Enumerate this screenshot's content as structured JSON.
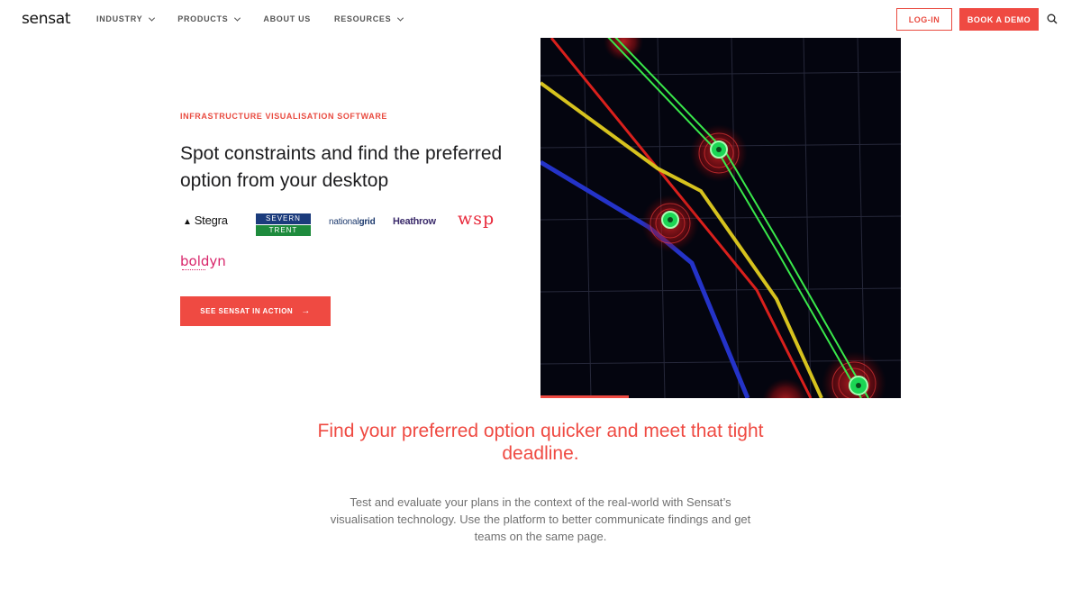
{
  "nav": {
    "logo": "sensat",
    "menu": [
      {
        "label": "INDUSTRY",
        "dropdown": true
      },
      {
        "label": "PRODUCTS",
        "dropdown": true
      },
      {
        "label": "ABOUT US",
        "dropdown": false
      },
      {
        "label": "RESOURCES",
        "dropdown": true
      }
    ],
    "login_label": "LOG-IN",
    "demo_label": "BOOK A DEMO",
    "search_icon": "search-icon"
  },
  "hero": {
    "eyebrow": "INFRASTRUCTURE VISUALISATION SOFTWARE",
    "headline": "Spot constraints and find the preferred option from your desktop",
    "logos": {
      "stegra": "Stegra",
      "severn_top": "SEVERN",
      "severn_bottom": "TRENT",
      "national": "national",
      "grid": "grid",
      "heathrow": "Heathrow",
      "wsp": "wsp",
      "boldyn": "boldyn"
    },
    "cta_label": "SEE SENSAT IN ACTION",
    "cta_icon": "arrow-right-icon"
  },
  "section": {
    "title": "Find your preferred option quicker and meet that tight deadline.",
    "body": "Test and evaluate your plans in the context of the real-world with Sensat’s visualisation technology. Use the platform to better communicate findings and get teams on the same page."
  },
  "colors": {
    "accent": "#ef4a42",
    "visual_bg": "#04050f",
    "route_green": "#39e84a",
    "route_red": "#e8231c",
    "route_yellow": "#d6c21e",
    "route_blue": "#2433c8"
  }
}
